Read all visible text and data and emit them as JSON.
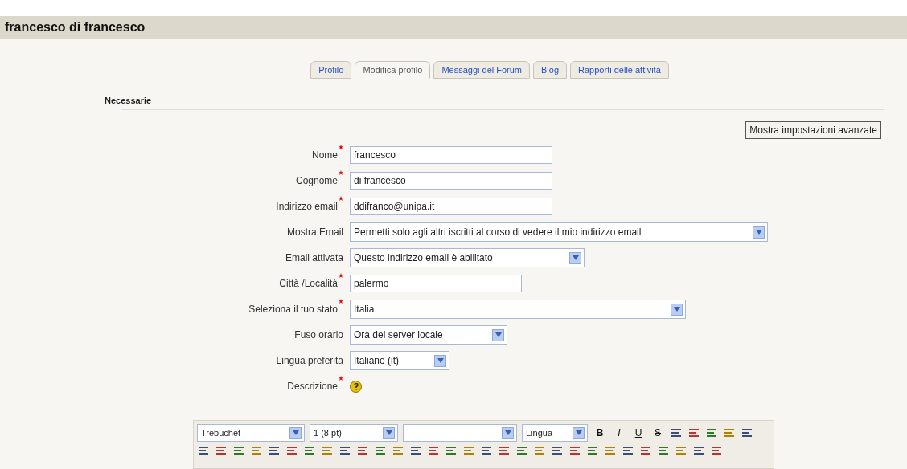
{
  "header": {
    "title": "francesco di francesco"
  },
  "tabs": [
    {
      "label": "Profilo",
      "selected": false
    },
    {
      "label": "Modifica profilo",
      "selected": true
    },
    {
      "label": "Messaggi del Forum",
      "selected": false
    },
    {
      "label": "Blog",
      "selected": false
    },
    {
      "label": "Rapporti delle attività",
      "selected": false
    }
  ],
  "section": {
    "legend": "Necessarie",
    "advanced_button": "Mostra impostazioni avanzate"
  },
  "fields": [
    {
      "label": "Nome",
      "required": true,
      "kind": "text",
      "value": "francesco"
    },
    {
      "label": "Cognome",
      "required": true,
      "kind": "text",
      "value": "di francesco"
    },
    {
      "label": "Indirizzo email",
      "required": true,
      "kind": "text",
      "value": "ddifranco@unipa.it"
    },
    {
      "label": "Mostra Email",
      "required": false,
      "kind": "select",
      "value": "Permetti solo agli altri iscritti al corso di vedere il mio indirizzo email"
    },
    {
      "label": "Email attivata",
      "required": false,
      "kind": "select",
      "value": "Questo indirizzo email è abilitato"
    },
    {
      "label": "Città /Località",
      "required": true,
      "kind": "text",
      "value": "palermo"
    },
    {
      "label": "Seleziona il tuo stato",
      "required": true,
      "kind": "select",
      "value": "Italia"
    },
    {
      "label": "Fuso orario",
      "required": false,
      "kind": "select",
      "value": "Ora del server locale"
    },
    {
      "label": "Lingua preferita",
      "required": false,
      "kind": "select",
      "value": "Italiano (it)"
    },
    {
      "label": "Descrizione",
      "required": true,
      "kind": "help"
    }
  ],
  "editor": {
    "selects": [
      {
        "kind": "font",
        "value": "Trebuchet"
      },
      {
        "kind": "size",
        "value": "1 (8 pt)"
      },
      {
        "kind": "style"
      },
      {
        "kind": "language",
        "value": "Lingua"
      }
    ],
    "format_buttons": [
      "B",
      "I",
      "U",
      "S"
    ]
  }
}
